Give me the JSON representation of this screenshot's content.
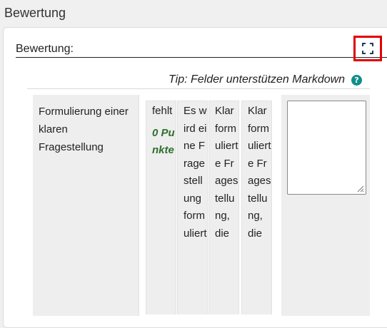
{
  "page": {
    "title": "Bewertung"
  },
  "field": {
    "label": "Bewertung:"
  },
  "tip": {
    "text": "Tip: Felder unterstützen Markdown",
    "help_glyph": "?"
  },
  "rubric": {
    "criterion": "Formulierung einer klaren Fragestellung",
    "levels": [
      {
        "text": "fehlt",
        "points": "0 Punkte"
      },
      {
        "text": "Es wird eine Fragestellung formuliert"
      },
      {
        "text": "Klar formulierte Fragestellung, die"
      },
      {
        "text": "Klar formulierte Fragestellung, die"
      }
    ],
    "remark_value": ""
  },
  "colors": {
    "highlight_border": "#e00000",
    "help_icon": "#118e8b",
    "points_text": "#2f6f2f"
  },
  "icons": {
    "fullscreen": "fullscreen-icon",
    "help": "help-icon",
    "resize": "resize-grip-icon"
  }
}
